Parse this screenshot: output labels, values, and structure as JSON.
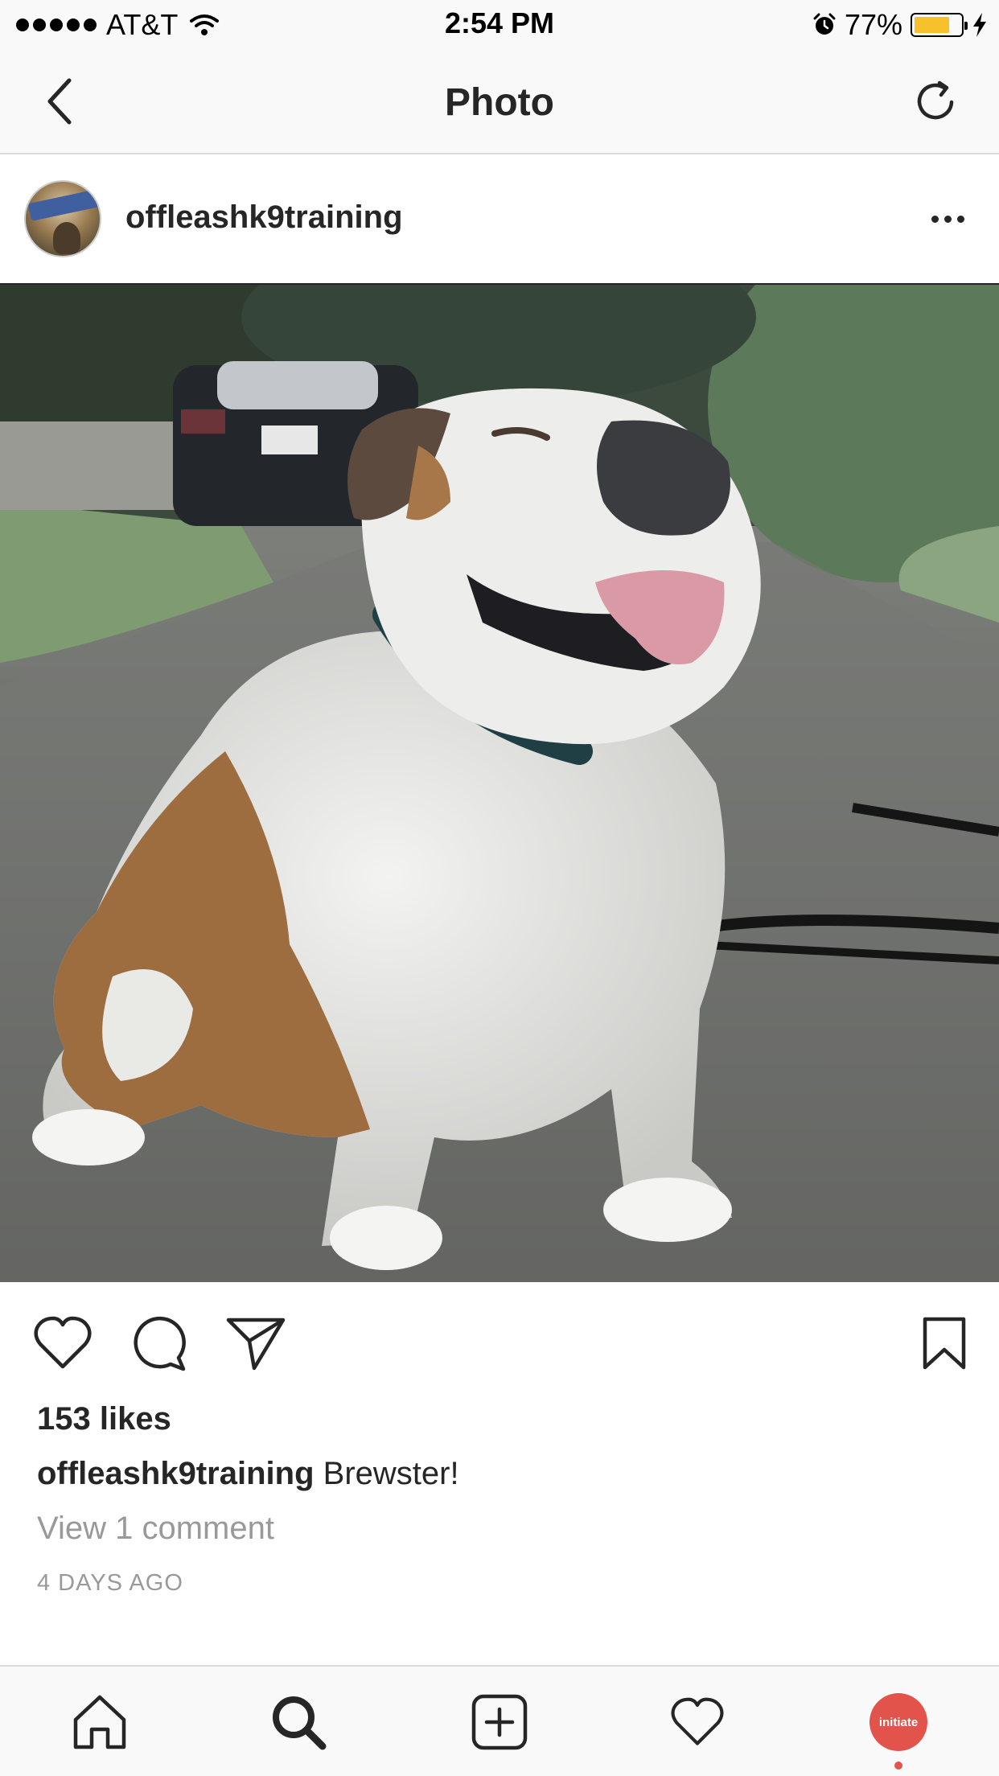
{
  "status_bar": {
    "carrier": "AT&T",
    "time": "2:54 PM",
    "battery_percent": "77%",
    "battery_level": 0.77,
    "battery_color": "#f6c12b",
    "icons": [
      "signal-dots-icon",
      "wifi-icon",
      "alarm-icon",
      "battery-icon",
      "charging-bolt-icon"
    ]
  },
  "nav": {
    "title": "Photo",
    "back_icon": "chevron-left-icon",
    "refresh_icon": "refresh-icon"
  },
  "post": {
    "username": "offleashk9training",
    "avatar_text": "OFF LEASH",
    "more_icon": "more-horizontal-icon",
    "photo_subject": "english-bulldog-photo",
    "likes": "153 likes",
    "caption_user": "offleashk9training",
    "caption_text": "Brewster!",
    "view_comments": "View 1 comment",
    "timestamp": "4 DAYS AGO"
  },
  "actions": {
    "icons": [
      "heart-icon",
      "comment-icon",
      "share-icon",
      "bookmark-icon"
    ]
  },
  "tab_bar": {
    "icons": [
      "home-icon",
      "search-icon",
      "add-post-icon",
      "activity-heart-icon",
      "profile-avatar"
    ],
    "profile_label": "initiate"
  },
  "colors": {
    "text": "#262626",
    "muted": "#999999",
    "divider": "#dbdbdb",
    "bar_bg": "#f9f9f9",
    "profile_accent": "#e2544b"
  }
}
